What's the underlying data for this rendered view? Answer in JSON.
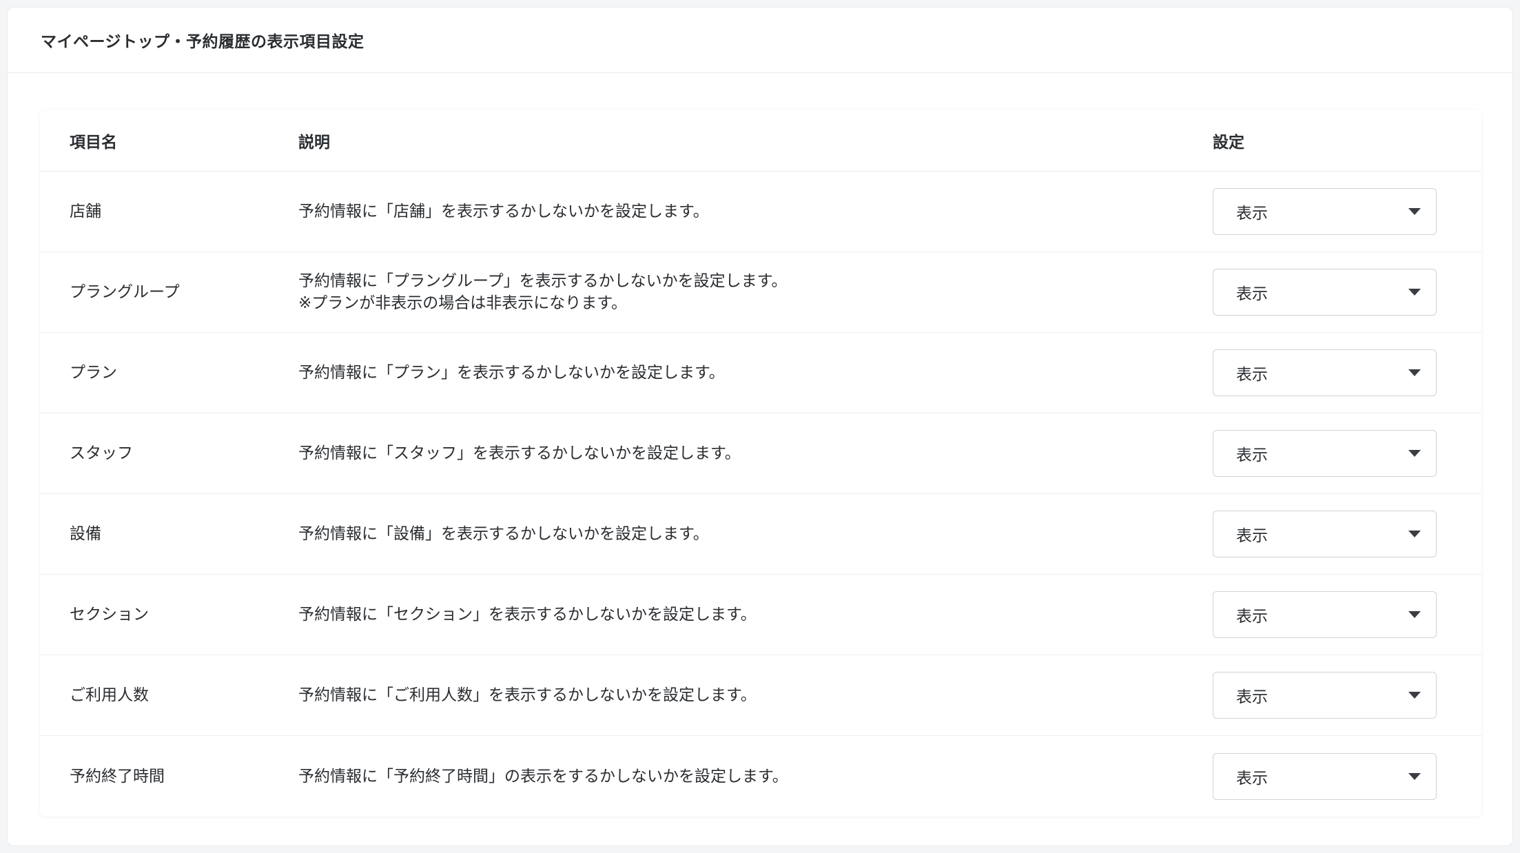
{
  "page": {
    "title": "マイページトップ・予約履歴の表示項目設定"
  },
  "table": {
    "headers": {
      "name": "項目名",
      "description": "説明",
      "setting": "設定"
    },
    "rows": [
      {
        "name": "店舗",
        "description": [
          "予約情報に「店舗」を表示するかしないかを設定します。"
        ],
        "setting": "表示"
      },
      {
        "name": "プラングループ",
        "description": [
          "予約情報に「プラングループ」を表示するかしないかを設定します。",
          "※プランが非表示の場合は非表示になります。"
        ],
        "setting": "表示"
      },
      {
        "name": "プラン",
        "description": [
          "予約情報に「プラン」を表示するかしないかを設定します。"
        ],
        "setting": "表示"
      },
      {
        "name": "スタッフ",
        "description": [
          "予約情報に「スタッフ」を表示するかしないかを設定します。"
        ],
        "setting": "表示"
      },
      {
        "name": "設備",
        "description": [
          "予約情報に「設備」を表示するかしないかを設定します。"
        ],
        "setting": "表示"
      },
      {
        "name": "セクション",
        "description": [
          "予約情報に「セクション」を表示するかしないかを設定します。"
        ],
        "setting": "表示"
      },
      {
        "name": "ご利用人数",
        "description": [
          "予約情報に「ご利用人数」を表示するかしないかを設定します。"
        ],
        "setting": "表示"
      },
      {
        "name": "予約終了時間",
        "description": [
          "予約情報に「予約終了時間」の表示をするかしないかを設定します。"
        ],
        "setting": "表示"
      }
    ]
  },
  "icons": {
    "select_caret": "chevron-down-icon"
  },
  "colors": {
    "background": "#f4f5f7",
    "card": "#ffffff",
    "text": "#2a2d31",
    "border": "#cfd3d9",
    "divider": "#eceef1"
  }
}
